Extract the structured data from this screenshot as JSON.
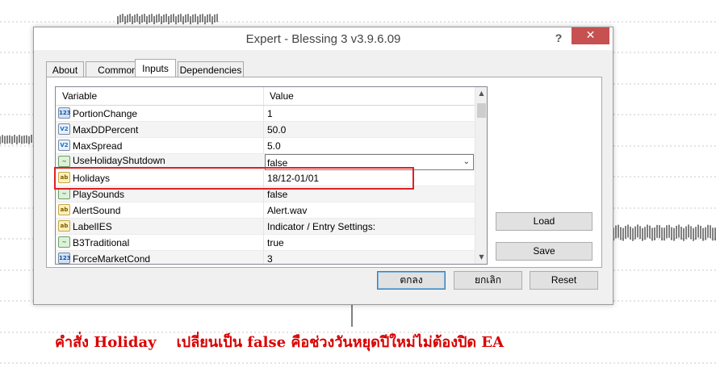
{
  "window": {
    "title": "Expert - Blessing 3 v3.9.6.09",
    "help_label": "?",
    "close_label": "✕"
  },
  "tabs": [
    {
      "label": "About",
      "active": false
    },
    {
      "label": "Common",
      "active": false
    },
    {
      "label": "Inputs",
      "active": true
    },
    {
      "label": "Dependencies",
      "active": false
    }
  ],
  "grid": {
    "headers": {
      "variable": "Variable",
      "value": "Value"
    },
    "rows": [
      {
        "icon": "int-icon",
        "icon_text": "123",
        "name": "PortionChange",
        "value": "1"
      },
      {
        "icon": "double-icon",
        "icon_text": "V2",
        "name": "MaxDDPercent",
        "value": "50.0"
      },
      {
        "icon": "double-icon",
        "icon_text": "V2",
        "name": "MaxSpread",
        "value": "5.0"
      },
      {
        "icon": "bool-icon",
        "icon_text": "~",
        "name": "UseHolidayShutdown",
        "value": "false",
        "editing": true
      },
      {
        "icon": "string-icon",
        "icon_text": "ab",
        "name": "Holidays",
        "value": "18/12-01/01"
      },
      {
        "icon": "bool-icon",
        "icon_text": "~",
        "name": "PlaySounds",
        "value": "false"
      },
      {
        "icon": "string-icon",
        "icon_text": "ab",
        "name": "AlertSound",
        "value": "Alert.wav"
      },
      {
        "icon": "string-icon",
        "icon_text": "ab",
        "name": "LabelIES",
        "value": "Indicator / Entry Settings:"
      },
      {
        "icon": "bool-icon",
        "icon_text": "~",
        "name": "B3Traditional",
        "value": "true"
      },
      {
        "icon": "int-icon",
        "icon_text": "123",
        "name": "ForceMarketCond",
        "value": "3"
      }
    ]
  },
  "buttons": {
    "load": "Load",
    "save": "Save",
    "ok": "ตกลง",
    "cancel": "ยกเลิก",
    "reset": "Reset"
  },
  "annotation": {
    "caption": "คำสั่ง Holiday    เปลี่ยนเป็น false คือช่วงวันหยุดปีใหม่ไม่ต้องปิด EA",
    "color": "#d90000"
  }
}
